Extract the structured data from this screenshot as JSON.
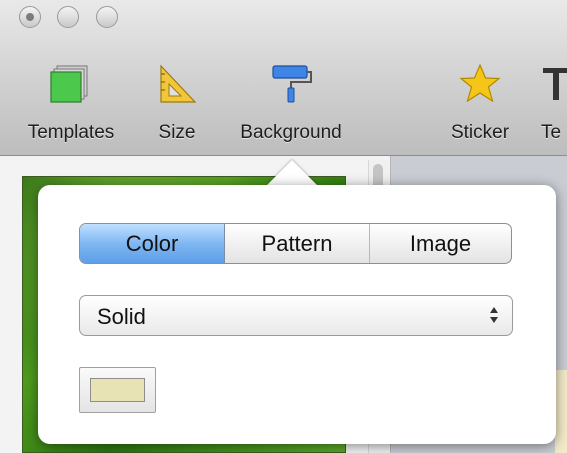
{
  "toolbar": {
    "items": [
      {
        "label": "Templates",
        "icon": "templates-icon"
      },
      {
        "label": "Size",
        "icon": "ruler-triangle-icon"
      },
      {
        "label": "Background",
        "icon": "paint-roller-icon"
      },
      {
        "label": "Sticker",
        "icon": "star-icon"
      },
      {
        "label": "Te",
        "icon": "text-icon"
      }
    ]
  },
  "popover": {
    "segments": [
      "Color",
      "Pattern",
      "Image"
    ],
    "selected_segment": "Color",
    "fill_type": "Solid",
    "swatch_color": "#e8e3b4"
  },
  "colors": {
    "accent_selected": "#6aa6ec",
    "templates_icon": "#4cc94c",
    "sticker_star": "#f5c518"
  }
}
